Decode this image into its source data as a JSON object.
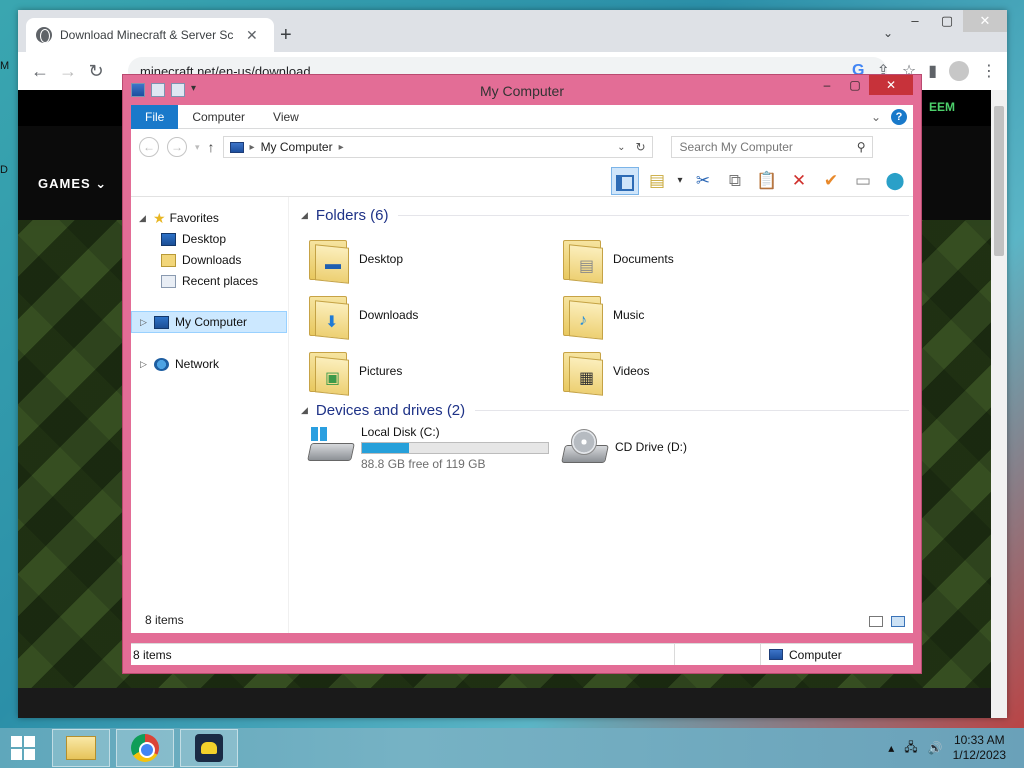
{
  "browser": {
    "tab_title": "Download Minecraft & Server Sc",
    "url": "minecraft.net/en-us/download",
    "nav_games": "GAMES",
    "nav_redeem": "EEM"
  },
  "explorer": {
    "title": "My Computer",
    "ribbon_tabs": [
      "File",
      "Computer",
      "View"
    ],
    "address": "My Computer",
    "search_placeholder": "Search My Computer",
    "nav": {
      "favorites": "Favorites",
      "desktop": "Desktop",
      "downloads": "Downloads",
      "recent": "Recent places",
      "my_computer": "My Computer",
      "network": "Network"
    },
    "folders_header": "Folders (6)",
    "folders": [
      "Desktop",
      "Documents",
      "Downloads",
      "Music",
      "Pictures",
      "Videos"
    ],
    "drives_header": "Devices and drives (2)",
    "drives": [
      {
        "name": "Local Disk (C:)",
        "free": "88.8 GB free of 119 GB",
        "used_fraction": 0.254
      },
      {
        "name": "CD Drive (D:)"
      }
    ],
    "items_count": "8 items",
    "status_left": "8 items",
    "status_right": "Computer"
  },
  "taskbar": {
    "time": "10:33 AM",
    "date": "1/12/2023"
  },
  "colors": {
    "explorer_frame": "#e36d96",
    "accent": "#1979ca",
    "disk_fill": "#26a0da"
  }
}
